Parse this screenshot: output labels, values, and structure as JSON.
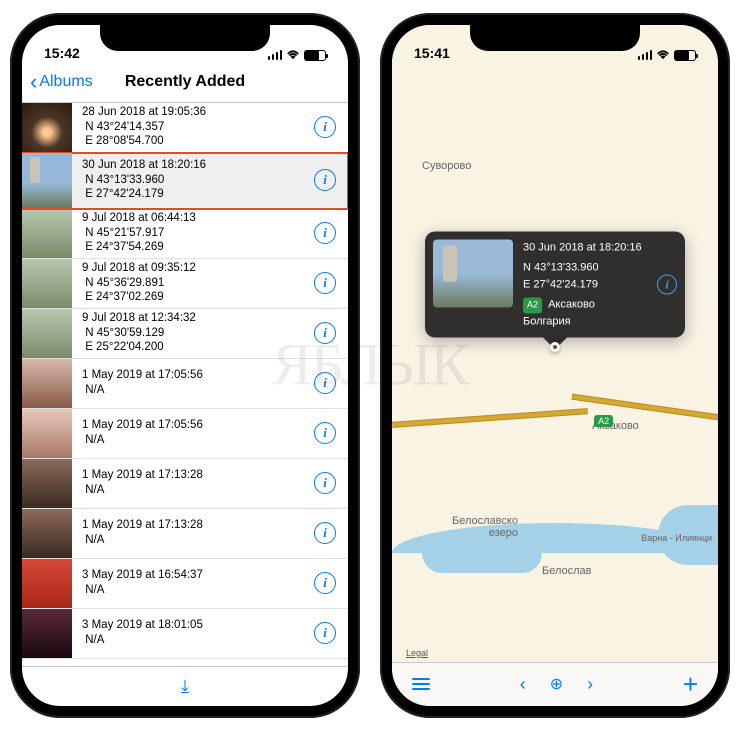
{
  "watermark": "ЯБЛЫК",
  "left_phone": {
    "status": {
      "time": "15:42"
    },
    "nav": {
      "back": "Albums",
      "title": "Recently Added"
    },
    "rows": [
      {
        "date": "28 Jun 2018 at 19:05:36",
        "lat": "N 43°24'14.357",
        "lon": "E 28°08'54.700",
        "thumb": "arch",
        "highlighted": false
      },
      {
        "date": "30 Jun 2018 at 18:20:16",
        "lat": "N 43°13'33.960",
        "lon": "E 27°42'24.179",
        "thumb": "tower",
        "highlighted": true
      },
      {
        "date": "9 Jul 2018 at 06:44:13",
        "lat": "N 45°21'57.917",
        "lon": "E 24°37'54.269",
        "thumb": "land",
        "highlighted": false
      },
      {
        "date": "9 Jul 2018 at 09:35:12",
        "lat": "N 45°36'29.891",
        "lon": "E 24°37'02.269",
        "thumb": "land",
        "highlighted": false
      },
      {
        "date": "9 Jul 2018 at 12:34:32",
        "lat": "N 45°30'59.129",
        "lon": "E 25°22'04.200",
        "thumb": "land",
        "highlighted": false
      },
      {
        "date": "1 May 2019 at 17:05:56",
        "lat": "N/A",
        "lon": "",
        "thumb": "people1",
        "highlighted": false
      },
      {
        "date": "1 May 2019 at 17:05:56",
        "lat": "N/A",
        "lon": "",
        "thumb": "people2",
        "highlighted": false
      },
      {
        "date": "1 May 2019 at 17:13:28",
        "lat": "N/A",
        "lon": "",
        "thumb": "people3",
        "highlighted": false
      },
      {
        "date": "1 May 2019 at 17:13:28",
        "lat": "N/A",
        "lon": "",
        "thumb": "people3",
        "highlighted": false
      },
      {
        "date": "3 May 2019 at 16:54:37",
        "lat": "N/A",
        "lon": "",
        "thumb": "red",
        "highlighted": false
      },
      {
        "date": "3 May 2019 at 18:01:05",
        "lat": "N/A",
        "lon": "",
        "thumb": "dark",
        "highlighted": false
      }
    ]
  },
  "right_phone": {
    "status": {
      "time": "15:41"
    },
    "towns": {
      "suvorovo": "Суворово",
      "aksakovo": "Аксаково",
      "beloslav_lake": "Белославско\nезеро",
      "beloslav": "Белослав",
      "varna": "Варна - Илиянци"
    },
    "route_badge": "А2",
    "callout": {
      "date": "30 Jun 2018 at 18:20:16",
      "lat": "N 43°13'33.960",
      "lon": "E 27°42'24.179",
      "place1": "Аксаково",
      "place2": "Болгария"
    },
    "legal": "Legal"
  }
}
